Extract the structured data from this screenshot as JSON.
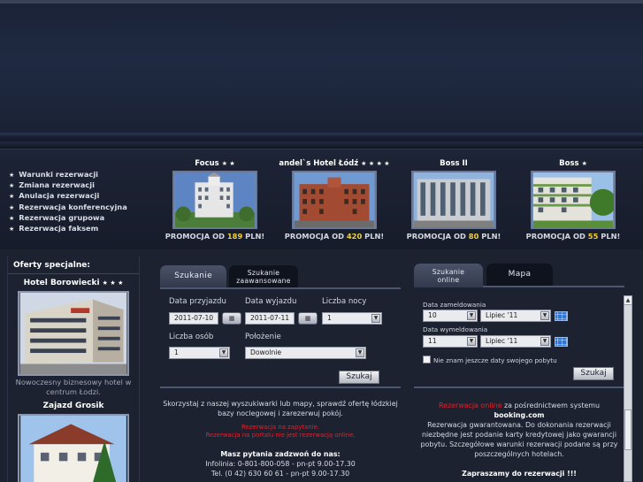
{
  "quick_links": [
    "Warunki rezerwacji",
    "Zmiana rezerwacji",
    "Anulacja rezerwacji",
    "Rezerwacja konferencyjna",
    "Rezerwacja grupowa",
    "Rezerwacja faksem"
  ],
  "hotels": [
    {
      "name": "Focus",
      "stars": "★ ★",
      "promo_prefix": "PROMOCJA OD",
      "price": "189",
      "promo_suffix": "PLN!"
    },
    {
      "name": "andel`s Hotel Łódź",
      "stars": "★ ★ ★ ★",
      "promo_prefix": "PROMOCJA OD",
      "price": "420",
      "promo_suffix": "PLN!"
    },
    {
      "name": "Boss II",
      "stars": "",
      "promo_prefix": "PROMOCJA OD",
      "price": "80",
      "promo_suffix": "PLN!"
    },
    {
      "name": "Boss",
      "stars": "★",
      "promo_prefix": "PROMOCJA OD",
      "price": "55",
      "promo_suffix": "PLN!"
    }
  ],
  "special_offers": {
    "title": "Oferty specjalne:",
    "offer1_name": "Hotel Borowiecki",
    "offer1_stars": "★ ★ ★",
    "offer1_desc_line1": "Nowoczesny biznesowy hotel w",
    "offer1_desc_line2": "centrum Łodzi.",
    "offer2_name": "Zajazd Grosik"
  },
  "search": {
    "tab_search": "Szukanie",
    "tab_advanced_line1": "Szukanie",
    "tab_advanced_line2": "zaawansowane",
    "arrival_label": "Data przyjazdu",
    "arrival_value": "2011-07-10",
    "departure_label": "Data wyjazdu",
    "departure_value": "2011-07-11",
    "nights_label": "Liczba nocy",
    "nights_value": "1",
    "persons_label": "Liczba osób",
    "persons_value": "1",
    "location_label": "Położenie",
    "location_value": "Dowolnie",
    "search_button": "Szukaj"
  },
  "mid_info": {
    "line1": "Skorzystaj z naszej wyszukiwarki lub mapy, sprawdź ofertę łódzkiej",
    "line2": "bazy noclegowej i zarezerwuj pokój.",
    "red1": "Rezerwacja na zapytanie.",
    "red2": "Rezerwacja na portalu nie jest rezerwacją online.",
    "phone_title": "Masz pytania zadzwoń do nas:",
    "phone1": "Infolinia: 0-801-800-058 - pn-pt 9.00-17.30",
    "phone2": "Tel. (0 42) 630 60 61 - pn-pt 9.00-17.30"
  },
  "online": {
    "tab_online_line1": "Szukanie",
    "tab_online_line2": "online",
    "tab_map": "Mapa",
    "checkin_label": "Data zameldowania",
    "checkin_day": "10",
    "checkin_month": "Lipiec '11",
    "checkout_label": "Data wymeldowania",
    "checkout_day": "11",
    "checkout_month": "Lipiec '11",
    "no_dates_label": "Nie znam jeszcze daty swojego pobytu",
    "search_button": "Szukaj"
  },
  "right_info": {
    "red_link": "Rezerwacja online",
    "line1_rest": " za pośrednictwem systemu",
    "brand": "booking.com",
    "line3": "Rezerwacja gwarantowana. Do dokonania rezerwacji",
    "line4": "niezbędne jest podanie karty kredytowej jako gwarancji",
    "line5": "pobytu. Szczegółowe warunki rezerwacji podane są przy",
    "line6": "poszczególnych hotelach.",
    "invite": "Zapraszamy do rezerwacji !!!"
  },
  "colors": {
    "background": "#1c2230",
    "price_accent": "#f1d23a",
    "alert_red": "#e4202a",
    "grid_icon": "#2f76d6"
  }
}
